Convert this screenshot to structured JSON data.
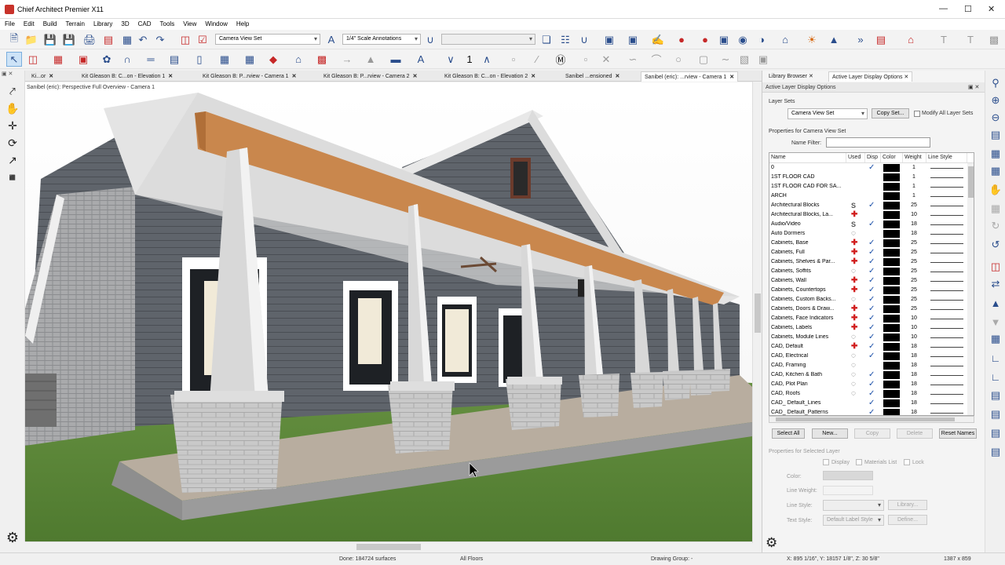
{
  "window": {
    "title": "Chief Architect Premier X11"
  },
  "menu": [
    "File",
    "Edit",
    "Build",
    "Terrain",
    "Library",
    "3D",
    "CAD",
    "Tools",
    "View",
    "Window",
    "Help"
  ],
  "toolbar": {
    "layer_set": "Camera View Set",
    "scale": "1/4\" Scale Annotations"
  },
  "tabs": [
    {
      "label": "Ki...or"
    },
    {
      "label": "Kit Gleason B: C...on - Elevation 1"
    },
    {
      "label": "Kit Gleason B: P...rview - Camera 1"
    },
    {
      "label": "Kit Gleason B: P...rview - Camera 2"
    },
    {
      "label": "Kit Gleason B: C...on - Elevation 2"
    },
    {
      "label": "Sanibel ...ensioned"
    },
    {
      "label": "Sanibel (eric): ...rview - Camera 1"
    }
  ],
  "view_label": "Sanibel (eric): Perspective Full Overview - Camera 1",
  "panel": {
    "tabs": [
      "Library Browser",
      "Active Layer Display Options"
    ],
    "title": "Active Layer Display Options",
    "layer_sets_label": "Layer Sets",
    "layer_set_value": "Camera View Set",
    "copy_set_button": "Copy Set...",
    "modify_all_label": "Modify All Layer Sets",
    "properties_label": "Properties for Camera View Set",
    "name_filter_label": "Name Filter:",
    "name_filter_value": "",
    "columns": [
      "Name",
      "Used",
      "Disp",
      "Color",
      "Weight",
      "Line Style"
    ],
    "layers": [
      {
        "name": "0",
        "used": "",
        "disp": true,
        "weight": "1"
      },
      {
        "name": "1ST FLOOR CAD",
        "used": "",
        "disp": false,
        "weight": "1"
      },
      {
        "name": "1ST FLOOR CAD FOR SA...",
        "used": "",
        "disp": false,
        "weight": "1"
      },
      {
        "name": "ARCH",
        "used": "",
        "disp": false,
        "weight": "1"
      },
      {
        "name": "Architectural Blocks",
        "used": "S",
        "disp": true,
        "weight": "25"
      },
      {
        "name": "Architectural Blocks, La...",
        "used": "+",
        "disp": false,
        "weight": "10"
      },
      {
        "name": "Audio/Video",
        "used": "S",
        "disp": true,
        "weight": "18"
      },
      {
        "name": "Auto Dormers",
        "used": "bulb",
        "disp": false,
        "weight": "18"
      },
      {
        "name": "Cabinets,  Base",
        "used": "+",
        "disp": true,
        "weight": "25"
      },
      {
        "name": "Cabinets,  Full",
        "used": "+",
        "disp": true,
        "weight": "25"
      },
      {
        "name": "Cabinets,  Shelves & Par...",
        "used": "+",
        "disp": true,
        "weight": "25"
      },
      {
        "name": "Cabinets,  Soffits",
        "used": "bulb",
        "disp": true,
        "weight": "25"
      },
      {
        "name": "Cabinets,  Wall",
        "used": "+",
        "disp": true,
        "weight": "25"
      },
      {
        "name": "Cabinets, Countertops",
        "used": "+",
        "disp": true,
        "weight": "25"
      },
      {
        "name": "Cabinets, Custom Backs...",
        "used": "bulb",
        "disp": true,
        "weight": "25"
      },
      {
        "name": "Cabinets, Doors & Draw...",
        "used": "+",
        "disp": true,
        "weight": "25"
      },
      {
        "name": "Cabinets, Face Indicators",
        "used": "+",
        "disp": true,
        "weight": "10"
      },
      {
        "name": "Cabinets, Labels",
        "used": "+",
        "disp": true,
        "weight": "10"
      },
      {
        "name": "Cabinets, Module Lines",
        "used": "bulb",
        "disp": true,
        "weight": "10"
      },
      {
        "name": "CAD,  Default",
        "used": "+",
        "disp": true,
        "weight": "18"
      },
      {
        "name": "CAD, Electrical",
        "used": "bulb",
        "disp": true,
        "weight": "18"
      },
      {
        "name": "CAD, Framing",
        "used": "bulb",
        "disp": false,
        "weight": "18"
      },
      {
        "name": "CAD, Kitchen & Bath",
        "used": "bulb",
        "disp": true,
        "weight": "18"
      },
      {
        "name": "CAD, Plot Plan",
        "used": "bulb",
        "disp": true,
        "weight": "18"
      },
      {
        "name": "CAD, Roofs",
        "used": "bulb",
        "disp": true,
        "weight": "18"
      },
      {
        "name": "CAD_ Default_Lines",
        "used": "",
        "disp": true,
        "weight": "18"
      },
      {
        "name": "CAD_ Default_Patterns",
        "used": "",
        "disp": true,
        "weight": "18"
      }
    ],
    "buttons": [
      "Select All",
      "New...",
      "Copy",
      "Delete",
      "Reset Names"
    ],
    "selected_props_label": "Properties for Selected Layer",
    "display_label": "Display",
    "materials_label": "Materials List",
    "lock_label": "Lock",
    "color_label": "Color:",
    "line_weight_label": "Line Weight:",
    "line_style_label": "Line Style:",
    "library_button": "Library...",
    "text_style_label": "Text Style:",
    "text_style_value": "Default Label Style",
    "define_button": "Define..."
  },
  "status": {
    "done": "Done:  184724 surfaces",
    "floors": "All Floors",
    "drawing_group": "Drawing Group: -",
    "coords": "X: 895 1/16\", Y: 18157 1/8\", Z: 30 5/8\"",
    "size": "1387 x 859"
  },
  "colors": {
    "accent": "#1a4fa8",
    "siding": "#5f646b",
    "grass": "#5f8b3a",
    "beam": "#c9874d",
    "pier": "#c5c5c5"
  }
}
